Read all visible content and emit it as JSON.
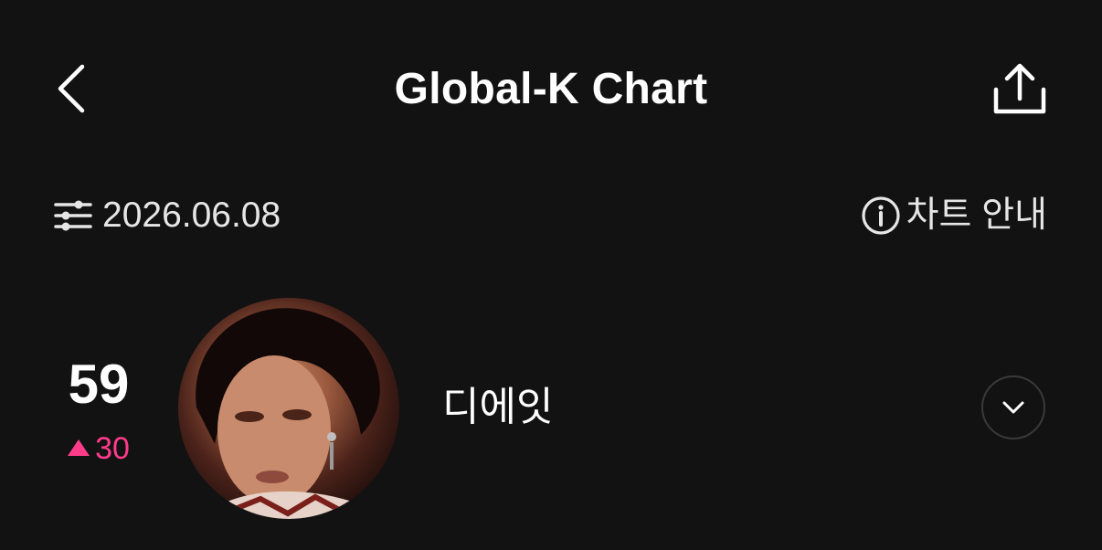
{
  "header": {
    "title": "Global-K Chart",
    "back_icon": "chevron-left-icon",
    "share_icon": "share-upload-icon"
  },
  "filter": {
    "date": "2026.06.08",
    "filter_icon": "sliders-icon",
    "info_label": "차트 안내",
    "info_icon": "info-circle-icon"
  },
  "chart_entry": {
    "rank": "59",
    "change_value": "30",
    "change_direction": "up",
    "change_color": "#ff3c8a",
    "artist_name": "디에잇",
    "expand_icon": "chevron-down-icon"
  },
  "colors": {
    "background": "#121212",
    "text": "#ffffff",
    "accent": "#ff3c8a"
  }
}
